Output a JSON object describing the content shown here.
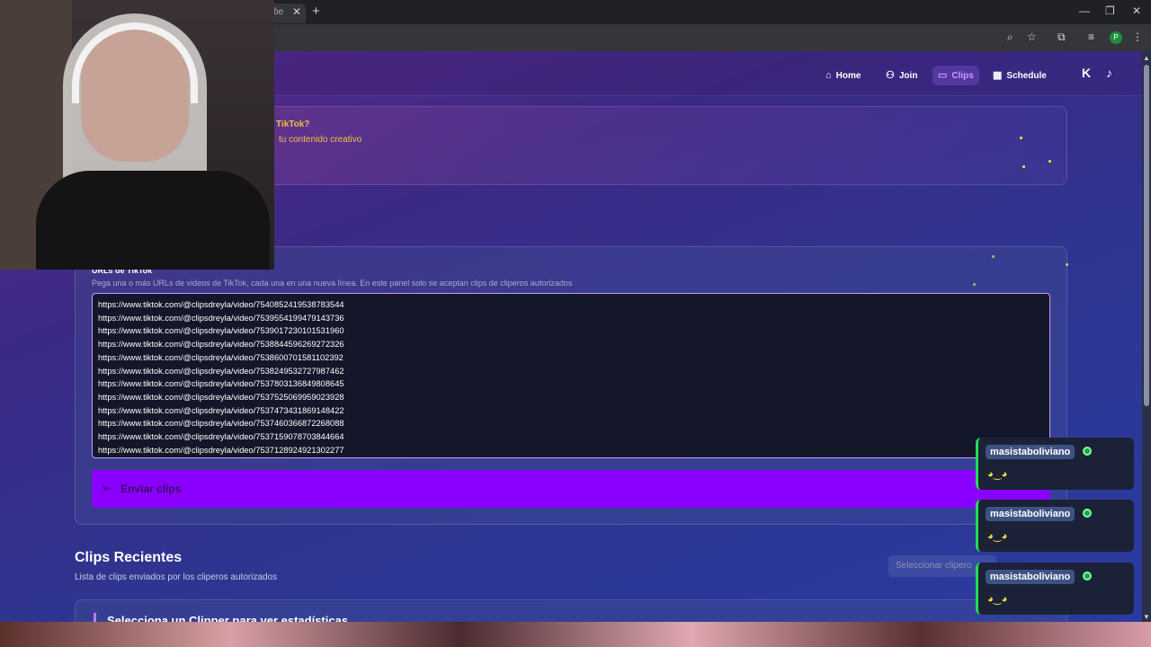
{
  "browser": {
    "tab_fragment": "ɓe",
    "close_glyph": "✕",
    "new_tab_glyph": "+",
    "profile_initial": "P"
  },
  "nav": {
    "items": [
      {
        "icon": "home-icon",
        "glyph": "⌂",
        "label": "Home"
      },
      {
        "icon": "users-icon",
        "glyph": "⚇",
        "label": "Join"
      },
      {
        "icon": "video-icon",
        "glyph": "▭",
        "label": "Clips",
        "active": true
      },
      {
        "icon": "calendar-icon",
        "glyph": "▦",
        "label": "Schedule"
      }
    ],
    "kick_glyph": "K",
    "tiktok_glyph": "♪"
  },
  "banner": {
    "title": "TikTok?",
    "subtitle": "tu contenido creativo"
  },
  "form": {
    "label": "URLs de TikTok",
    "help": "Pega una o más URLs de videos de TikTok, cada una en una nueva línea. En este panel solo se aceptan clips de cliperos autorizados",
    "urls": [
      "https://www.tiktok.com/@clipsdreyla/video/7540852419538783544",
      "https://www.tiktok.com/@clipsdreyla/video/7539554199479143736",
      "https://www.tiktok.com/@clipsdreyla/video/7539017230101531960",
      "https://www.tiktok.com/@clipsdreyla/video/7538844596269272326",
      "https://www.tiktok.com/@clipsdreyla/video/7538600701581102392",
      "https://www.tiktok.com/@clipsdreyla/video/7538249532727987462",
      "https://www.tiktok.com/@clipsdreyla/video/7537803136849808645",
      "https://www.tiktok.com/@clipsdreyla/video/7537525069959023928",
      "https://www.tiktok.com/@clipsdreyla/video/7537473431869148422",
      "https://www.tiktok.com/@clipsdreyla/video/7537460366872268088",
      "https://www.tiktok.com/@clipsdreyla/video/7537159078703844664",
      "https://www.tiktok.com/@clipsdreyla/video/7537128924921302277"
    ],
    "send_label": "Enviar clips"
  },
  "recent": {
    "title": "Clips Recientes",
    "subtitle": "Lista de clips enviados por los cliperos autorizados",
    "select_placeholder": "Seleccionar clipero",
    "stats_title": "Selecciona un Clipper para ver estadísticas"
  },
  "chat": {
    "messages": [
      {
        "user": "masistaboliviano",
        "emote": "◕‿◕"
      },
      {
        "user": "masistaboliviano",
        "emote": "◕‿◕"
      },
      {
        "user": "masistaboliviano",
        "emote": "◕‿◕"
      }
    ]
  },
  "colors": {
    "accent": "#8a00ff",
    "banner_text": "#f0c040",
    "chat_border": "#22dd55"
  }
}
